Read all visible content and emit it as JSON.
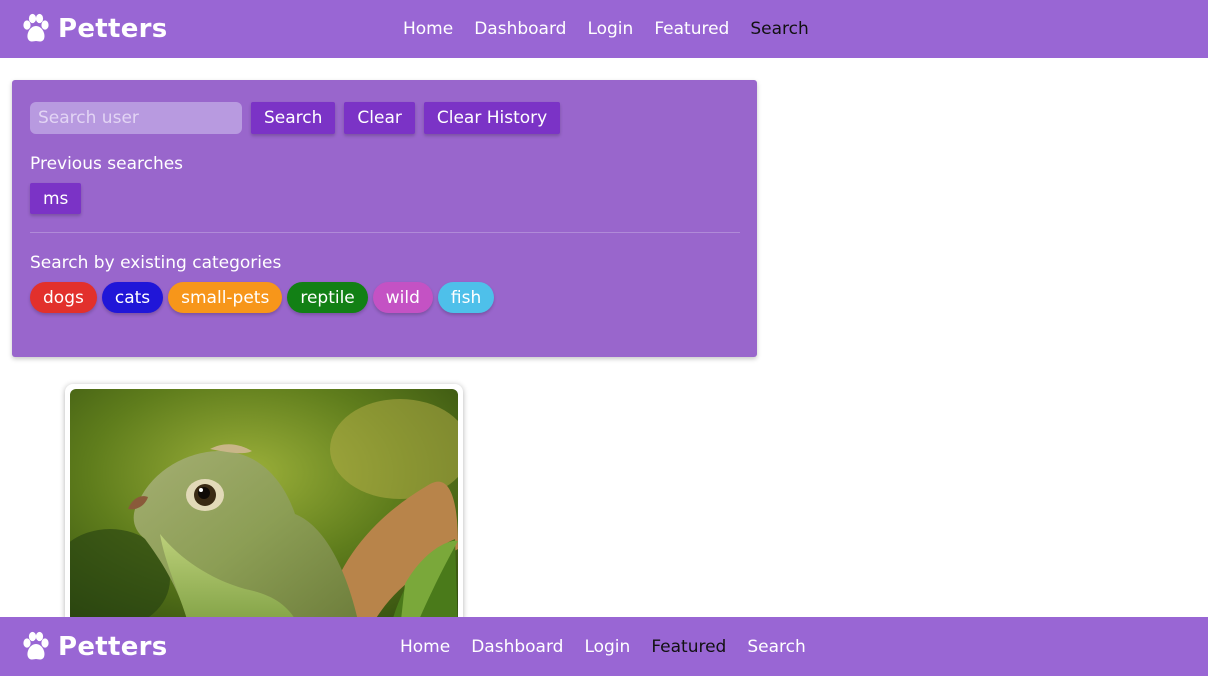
{
  "app": {
    "name": "Petters"
  },
  "nav": {
    "links": [
      "Home",
      "Dashboard",
      "Login",
      "Featured",
      "Search"
    ]
  },
  "search": {
    "placeholder": "Search user",
    "value": "",
    "search_label": "Search",
    "clear_label": "Clear",
    "clear_history_label": "Clear History"
  },
  "history": {
    "label": "Previous searches",
    "items": [
      "ms"
    ]
  },
  "categories": {
    "label": "Search by existing categories",
    "items": [
      {
        "label": "dogs",
        "color": "#e2302c"
      },
      {
        "label": "cats",
        "color": "#2016d8"
      },
      {
        "label": "small-pets",
        "color": "#f7961a"
      },
      {
        "label": "reptile",
        "color": "#128015"
      },
      {
        "label": "wild",
        "color": "#c452c4"
      },
      {
        "label": "fish",
        "color": "#4ec0ea"
      }
    ]
  },
  "colors": {
    "brand": "#9966d4",
    "panel": "#9966cc",
    "button": "#7b33c6"
  },
  "result_card": {
    "image": "lizard-photo"
  }
}
